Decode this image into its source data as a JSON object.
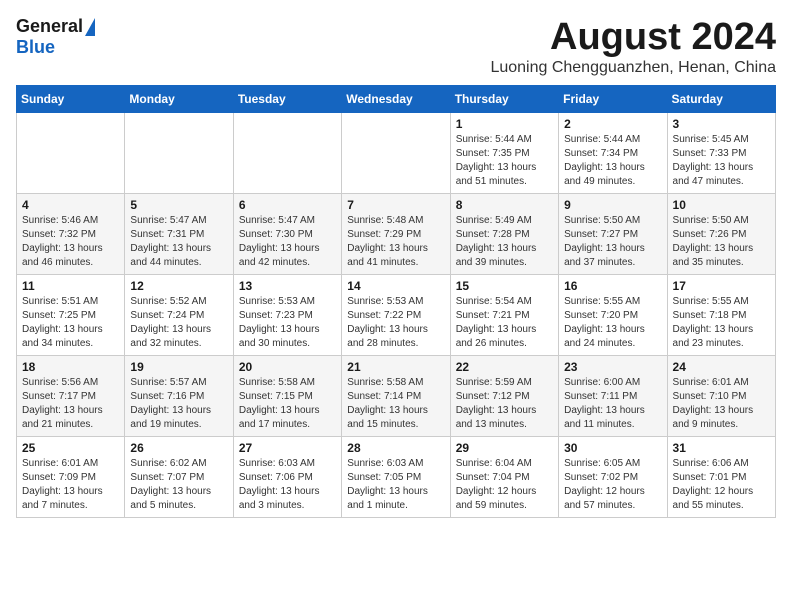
{
  "header": {
    "logo_general": "General",
    "logo_blue": "Blue",
    "month_title": "August 2024",
    "location": "Luoning Chengguanzhen, Henan, China"
  },
  "calendar": {
    "columns": [
      "Sunday",
      "Monday",
      "Tuesday",
      "Wednesday",
      "Thursday",
      "Friday",
      "Saturday"
    ],
    "weeks": [
      [
        {
          "day": "",
          "info": ""
        },
        {
          "day": "",
          "info": ""
        },
        {
          "day": "",
          "info": ""
        },
        {
          "day": "",
          "info": ""
        },
        {
          "day": "1",
          "info": "Sunrise: 5:44 AM\nSunset: 7:35 PM\nDaylight: 13 hours\nand 51 minutes."
        },
        {
          "day": "2",
          "info": "Sunrise: 5:44 AM\nSunset: 7:34 PM\nDaylight: 13 hours\nand 49 minutes."
        },
        {
          "day": "3",
          "info": "Sunrise: 5:45 AM\nSunset: 7:33 PM\nDaylight: 13 hours\nand 47 minutes."
        }
      ],
      [
        {
          "day": "4",
          "info": "Sunrise: 5:46 AM\nSunset: 7:32 PM\nDaylight: 13 hours\nand 46 minutes."
        },
        {
          "day": "5",
          "info": "Sunrise: 5:47 AM\nSunset: 7:31 PM\nDaylight: 13 hours\nand 44 minutes."
        },
        {
          "day": "6",
          "info": "Sunrise: 5:47 AM\nSunset: 7:30 PM\nDaylight: 13 hours\nand 42 minutes."
        },
        {
          "day": "7",
          "info": "Sunrise: 5:48 AM\nSunset: 7:29 PM\nDaylight: 13 hours\nand 41 minutes."
        },
        {
          "day": "8",
          "info": "Sunrise: 5:49 AM\nSunset: 7:28 PM\nDaylight: 13 hours\nand 39 minutes."
        },
        {
          "day": "9",
          "info": "Sunrise: 5:50 AM\nSunset: 7:27 PM\nDaylight: 13 hours\nand 37 minutes."
        },
        {
          "day": "10",
          "info": "Sunrise: 5:50 AM\nSunset: 7:26 PM\nDaylight: 13 hours\nand 35 minutes."
        }
      ],
      [
        {
          "day": "11",
          "info": "Sunrise: 5:51 AM\nSunset: 7:25 PM\nDaylight: 13 hours\nand 34 minutes."
        },
        {
          "day": "12",
          "info": "Sunrise: 5:52 AM\nSunset: 7:24 PM\nDaylight: 13 hours\nand 32 minutes."
        },
        {
          "day": "13",
          "info": "Sunrise: 5:53 AM\nSunset: 7:23 PM\nDaylight: 13 hours\nand 30 minutes."
        },
        {
          "day": "14",
          "info": "Sunrise: 5:53 AM\nSunset: 7:22 PM\nDaylight: 13 hours\nand 28 minutes."
        },
        {
          "day": "15",
          "info": "Sunrise: 5:54 AM\nSunset: 7:21 PM\nDaylight: 13 hours\nand 26 minutes."
        },
        {
          "day": "16",
          "info": "Sunrise: 5:55 AM\nSunset: 7:20 PM\nDaylight: 13 hours\nand 24 minutes."
        },
        {
          "day": "17",
          "info": "Sunrise: 5:55 AM\nSunset: 7:18 PM\nDaylight: 13 hours\nand 23 minutes."
        }
      ],
      [
        {
          "day": "18",
          "info": "Sunrise: 5:56 AM\nSunset: 7:17 PM\nDaylight: 13 hours\nand 21 minutes."
        },
        {
          "day": "19",
          "info": "Sunrise: 5:57 AM\nSunset: 7:16 PM\nDaylight: 13 hours\nand 19 minutes."
        },
        {
          "day": "20",
          "info": "Sunrise: 5:58 AM\nSunset: 7:15 PM\nDaylight: 13 hours\nand 17 minutes."
        },
        {
          "day": "21",
          "info": "Sunrise: 5:58 AM\nSunset: 7:14 PM\nDaylight: 13 hours\nand 15 minutes."
        },
        {
          "day": "22",
          "info": "Sunrise: 5:59 AM\nSunset: 7:12 PM\nDaylight: 13 hours\nand 13 minutes."
        },
        {
          "day": "23",
          "info": "Sunrise: 6:00 AM\nSunset: 7:11 PM\nDaylight: 13 hours\nand 11 minutes."
        },
        {
          "day": "24",
          "info": "Sunrise: 6:01 AM\nSunset: 7:10 PM\nDaylight: 13 hours\nand 9 minutes."
        }
      ],
      [
        {
          "day": "25",
          "info": "Sunrise: 6:01 AM\nSunset: 7:09 PM\nDaylight: 13 hours\nand 7 minutes."
        },
        {
          "day": "26",
          "info": "Sunrise: 6:02 AM\nSunset: 7:07 PM\nDaylight: 13 hours\nand 5 minutes."
        },
        {
          "day": "27",
          "info": "Sunrise: 6:03 AM\nSunset: 7:06 PM\nDaylight: 13 hours\nand 3 minutes."
        },
        {
          "day": "28",
          "info": "Sunrise: 6:03 AM\nSunset: 7:05 PM\nDaylight: 13 hours\nand 1 minute."
        },
        {
          "day": "29",
          "info": "Sunrise: 6:04 AM\nSunset: 7:04 PM\nDaylight: 12 hours\nand 59 minutes."
        },
        {
          "day": "30",
          "info": "Sunrise: 6:05 AM\nSunset: 7:02 PM\nDaylight: 12 hours\nand 57 minutes."
        },
        {
          "day": "31",
          "info": "Sunrise: 6:06 AM\nSunset: 7:01 PM\nDaylight: 12 hours\nand 55 minutes."
        }
      ]
    ]
  }
}
